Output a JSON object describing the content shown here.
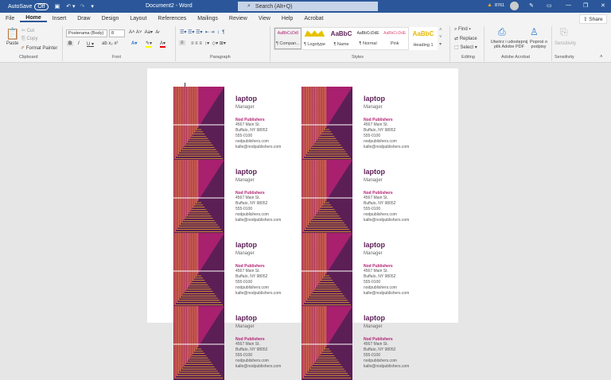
{
  "titlebar": {
    "autosave": "AutoSave",
    "autosave_state": "Off",
    "title": "Document2 - Word",
    "search": "Search (Alt+Q)",
    "user_code": "8761"
  },
  "tabs": [
    "File",
    "Home",
    "Insert",
    "Draw",
    "Design",
    "Layout",
    "References",
    "Mailings",
    "Review",
    "View",
    "Help",
    "Acrobat"
  ],
  "share": "Share",
  "clipboard": {
    "paste": "Paste",
    "cut": "Cut",
    "copy": "Copy",
    "format_painter": "Format Painter",
    "label": "Clipboard"
  },
  "font": {
    "name": "Posterama (Body)",
    "size": "8",
    "label": "Font"
  },
  "paragraph": {
    "label": "Paragraph"
  },
  "styles": {
    "label": "Styles",
    "items": [
      {
        "sample": "AaBbCcDdI",
        "name": "¶ Compan..."
      },
      {
        "sample": "",
        "name": "¶ Logotype"
      },
      {
        "sample": "AaBbC",
        "name": "¶ Name"
      },
      {
        "sample": "AaBbCcDdE",
        "name": "¶ Normal"
      },
      {
        "sample": "AaBbCcDdE",
        "name": "Pink"
      },
      {
        "sample": "AaBbC",
        "name": "Heading 1"
      }
    ]
  },
  "editing": {
    "find": "Find",
    "replace": "Replace",
    "select": "Select",
    "label": "Editing"
  },
  "acrobat": {
    "create": "Utwórz i udostępnij plik Adobe PDF",
    "sign": "Poproś o podpisy",
    "label": "Adobe Acrobat"
  },
  "sensitivity": {
    "button": "Sensitivity",
    "label": "Sensitivity"
  },
  "cards": [
    {
      "name": "laptop",
      "role": "Manager",
      "company": "Nod Publishers",
      "address": "4567 Main St.",
      "city": "Buffalo, NY 98052",
      "phone": "555-0100",
      "web": "nodpublishers.com",
      "email": "kalle@nodpublishers.com"
    }
  ],
  "colors": {
    "magenta": "#a8206e",
    "purple": "#5b1f56",
    "gold": "#e8a52a",
    "word_blue": "#2b579a"
  }
}
